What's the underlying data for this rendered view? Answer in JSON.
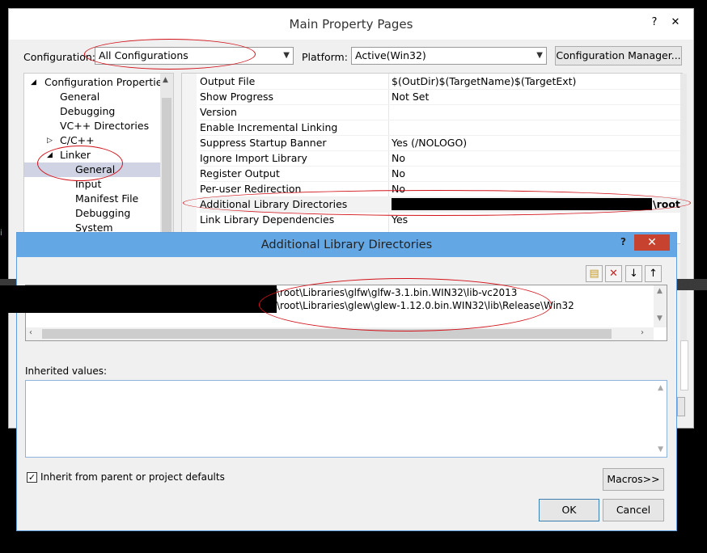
{
  "main": {
    "title": "Main Property Pages",
    "config_label": "Configuration:",
    "config_value": "All Configurations",
    "platform_label": "Platform:",
    "platform_value": "Active(Win32)",
    "config_manager": "Configuration Manager...",
    "tree": [
      {
        "label": "Configuration Properties",
        "expander": "◢"
      },
      {
        "label": "General"
      },
      {
        "label": "Debugging"
      },
      {
        "label": "VC++ Directories"
      },
      {
        "label": "C/C++",
        "expander": "▷"
      },
      {
        "label": "Linker",
        "expander": "◢"
      },
      {
        "label": "General"
      },
      {
        "label": "Input"
      },
      {
        "label": "Manifest File"
      },
      {
        "label": "Debugging"
      },
      {
        "label": "System"
      }
    ],
    "props": [
      {
        "name": "Output File",
        "value": "$(OutDir)$(TargetName)$(TargetExt)"
      },
      {
        "name": "Show Progress",
        "value": "Not Set"
      },
      {
        "name": "Version",
        "value": ""
      },
      {
        "name": "Enable Incremental Linking",
        "value": ""
      },
      {
        "name": "Suppress Startup Banner",
        "value": "Yes (/NOLOGO)"
      },
      {
        "name": "Ignore Import Library",
        "value": "No"
      },
      {
        "name": "Register Output",
        "value": "No"
      },
      {
        "name": "Per-user Redirection",
        "value": "No"
      },
      {
        "name": "Additional Library Directories",
        "value": "\\root\\"
      },
      {
        "name": "Link Library Dependencies",
        "value": "Yes"
      }
    ]
  },
  "dialog": {
    "title": "Additional Library Directories",
    "help": "?",
    "close": "✕",
    "paths": [
      "\\root\\Libraries\\glfw\\glfw-3.1.bin.WIN32\\lib-vc2013",
      "\\root\\Libraries\\glew\\glew-1.12.0.bin.WIN32\\lib\\Release\\Win32"
    ],
    "inherited_label": "Inherited values:",
    "inherit_checkbox_label": "Inherit from parent or project defaults",
    "macros_button": "Macros>>",
    "ok_button": "OK",
    "cancel_button": "Cancel"
  },
  "colors": {
    "annotation_red": "#d2121a",
    "dialog_titlebar": "#63a7e4",
    "close_red": "#c7432f"
  }
}
